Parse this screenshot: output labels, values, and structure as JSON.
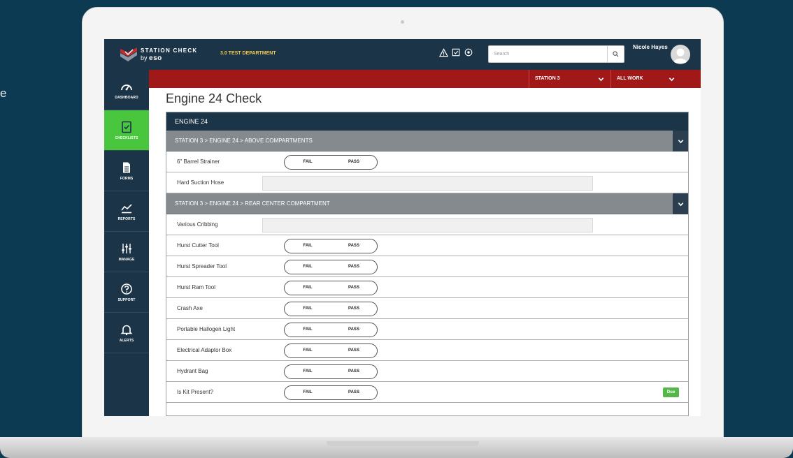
{
  "stray_text": "e",
  "app": {
    "logo_title": "STATION CHECK",
    "logo_by": "by",
    "logo_brand": "eso",
    "department": "3.0 TEST DEPARTMENT",
    "search_placeholder": "Search",
    "user_name": "Nicole Hayes"
  },
  "sidebar": [
    {
      "label": "DASHBOARD",
      "icon": "gauge-icon"
    },
    {
      "label": "CHECKLISTS",
      "icon": "checklist-icon"
    },
    {
      "label": "FORMS",
      "icon": "document-icon"
    },
    {
      "label": "REPORTS",
      "icon": "chart-icon"
    },
    {
      "label": "MANAGE",
      "icon": "sliders-icon"
    },
    {
      "label": "SUPPORT",
      "icon": "help-icon"
    },
    {
      "label": "ALERTS",
      "icon": "bell-icon"
    }
  ],
  "filters": {
    "station": "STATION 3",
    "work": "ALL WORK"
  },
  "page_title": "Engine 24 Check",
  "checklist": {
    "header": "ENGINE 24",
    "toggle_fail": "FAIL",
    "toggle_pass": "PASS",
    "sections": [
      {
        "title": "STATION 3 > ENGINE 24 > ABOVE COMPARTMENTS",
        "items": [
          {
            "label": "6\" Barrel Strainer",
            "type": "toggle"
          },
          {
            "label": "Hard Suction Hose",
            "type": "text"
          }
        ]
      },
      {
        "title": "STATION 3 > ENGINE 24 > REAR CENTER COMPARTMENT",
        "items": [
          {
            "label": "Various Cribbing",
            "type": "text"
          },
          {
            "label": "Hurst Cutter Tool",
            "type": "toggle"
          },
          {
            "label": "Hurst Spreader Tool",
            "type": "toggle"
          },
          {
            "label": "Hurst Ram Tool",
            "type": "toggle"
          },
          {
            "label": "Crash Axe",
            "type": "toggle"
          },
          {
            "label": "Portable Hallogen Light",
            "type": "toggle"
          },
          {
            "label": "Electrical Adaptor Box",
            "type": "toggle"
          },
          {
            "label": "Hydrant Bag",
            "type": "toggle"
          },
          {
            "label": "Is Kit Present?",
            "type": "toggle",
            "badge": "Due"
          }
        ]
      }
    ]
  },
  "colors": {
    "background": "#0c3a52",
    "nav": "#1c3447",
    "active": "#49c53e",
    "filterbar": "#a01818",
    "section": "#858a8f",
    "due": "#55b74a",
    "department": "#f2c94c"
  }
}
